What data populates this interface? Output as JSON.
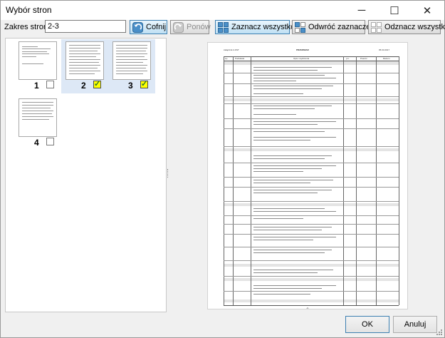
{
  "window": {
    "title": "Wybór stron",
    "minimize_glyph": "─",
    "maximize_glyph": "☐",
    "close_glyph": "✕"
  },
  "toolbar": {
    "range_label": "Zakres stron:",
    "range_value": "2-3",
    "undo_label": "Cofnij",
    "redo_label": "Ponów",
    "select_all_label": "Zaznacz wszystko",
    "invert_label": "Odwróć zaznaczenie",
    "deselect_all_label": "Odznacz wszystko",
    "undo_icon": "undo-arrow-icon",
    "redo_icon": "redo-arrow-icon",
    "select_all_icon": "select-all-icon",
    "invert_icon": "invert-selection-icon",
    "deselect_all_icon": "deselect-all-icon"
  },
  "pages": [
    {
      "number": "1",
      "checked": false,
      "selected": false,
      "check_glyph": ""
    },
    {
      "number": "2",
      "checked": true,
      "selected": true,
      "check_glyph": "✓"
    },
    {
      "number": "3",
      "checked": true,
      "selected": true,
      "check_glyph": "✓"
    },
    {
      "number": "4",
      "checked": false,
      "selected": false,
      "check_glyph": ""
    }
  ],
  "preview": {
    "header_left": "załącznik 2-KST",
    "header_center": "PRZEDMIAR",
    "header_right": "05.03.2017",
    "columns": [
      "Lp.",
      "Podstawa",
      "Opis i wyliczenia",
      "j.m.",
      "Poszcz.",
      "Razem"
    ],
    "page_number": "-3-"
  },
  "footer": {
    "ok_label": "OK",
    "cancel_label": "Anuluj"
  },
  "colors": {
    "accent": "#3c7fb1",
    "checked_fill": "#ffff00",
    "selected_cell": "#dde8f6"
  }
}
